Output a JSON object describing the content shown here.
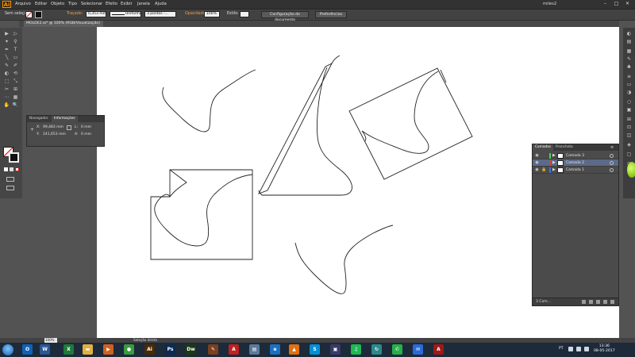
{
  "app": {
    "logo": "Ai",
    "menu": [
      "Arquivo",
      "Editar",
      "Objeto",
      "Tipo",
      "Selecionar",
      "Efeito",
      "Exibir",
      "Janela",
      "Ajuda"
    ],
    "user": "miles2",
    "window_buttons": [
      "–",
      "□",
      "✕"
    ]
  },
  "control": {
    "selection_label": "Sem seleção",
    "stroke_label": "Traçado:",
    "stroke_value": "0,353 mm",
    "profile_value": "Uniforme",
    "brush_value": "3 pontos -...",
    "opacity_label": "Opacidade:",
    "opacity_value": "100%",
    "style_label": "Estilo:",
    "doc_setup_button": "Configuração do documento",
    "prefs_button": "Preferências"
  },
  "document": {
    "tab_title": "MOLDE2.ai* @ 100% (RGB/Visualização)"
  },
  "tools": [
    "▶",
    "▷",
    "✦",
    "⚲",
    "✒",
    "T",
    "╲",
    "▭",
    "✎",
    "✐",
    "◐",
    "⟲",
    "⬚",
    "⤡",
    "✂",
    "⊞",
    "⋯",
    "▦",
    "✋",
    "🔍"
  ],
  "info_panel": {
    "tabs": [
      "Navegador",
      "Informações"
    ],
    "x_label": "X:",
    "x_value": "99,483 mm",
    "y_label": "Y:",
    "y_value": "241,653 mm",
    "w_label": "L:",
    "w_value": "0 mm",
    "h_label": "A:",
    "h_value": "0 mm"
  },
  "layers_panel": {
    "tabs": [
      "Camadas",
      "Prancheta"
    ],
    "layers": [
      {
        "name": "Camada 3",
        "color": "#4fd04f",
        "selected": false
      },
      {
        "name": "Camada 2",
        "color": "#e04040",
        "selected": true
      },
      {
        "name": "Camada 1",
        "color": "#3a6fe0",
        "selected": false
      }
    ],
    "count": "3 Cam..."
  },
  "status": {
    "zoom": "100%",
    "tool": "Seleção direta"
  },
  "taskbar": {
    "apps": [
      {
        "name": "outlook",
        "label": "O",
        "color": "#0f62b8"
      },
      {
        "name": "word",
        "label": "W",
        "color": "#2b5797"
      },
      {
        "name": "excel",
        "label": "X",
        "color": "#1f7a3a"
      },
      {
        "name": "explorer",
        "label": "▬",
        "color": "#e0b040"
      },
      {
        "name": "media",
        "label": "▶",
        "color": "#d06020"
      },
      {
        "name": "chrome",
        "label": "●",
        "color": "#3a9a40"
      },
      {
        "name": "illustrator",
        "label": "Ai",
        "color": "#4a2a00"
      },
      {
        "name": "photoshop",
        "label": "Ps",
        "color": "#0a2a55"
      },
      {
        "name": "dreamweaver",
        "label": "Dw",
        "color": "#1a3a14"
      },
      {
        "name": "tools",
        "label": "✎",
        "color": "#7a4020"
      },
      {
        "name": "acrobat",
        "label": "A",
        "color": "#c02020"
      },
      {
        "name": "docs",
        "label": "▤",
        "color": "#5a7a9a"
      },
      {
        "name": "edge",
        "label": "e",
        "color": "#1a70c0"
      },
      {
        "name": "vlc",
        "label": "▲",
        "color": "#e07010"
      },
      {
        "name": "skype",
        "label": "S",
        "color": "#0090d8"
      },
      {
        "name": "video",
        "label": "▣",
        "color": "#3a3a6a"
      },
      {
        "name": "spotify",
        "label": "♫",
        "color": "#1db954"
      },
      {
        "name": "sync",
        "label": "↻",
        "color": "#2a8a8a"
      },
      {
        "name": "whatsapp",
        "label": "✆",
        "color": "#25b04a"
      },
      {
        "name": "messenger",
        "label": "✉",
        "color": "#2a6ad8"
      },
      {
        "name": "autocad",
        "label": "A",
        "color": "#a01818"
      }
    ],
    "language": "PT",
    "time": "13:36",
    "date": "08-05-2017"
  }
}
